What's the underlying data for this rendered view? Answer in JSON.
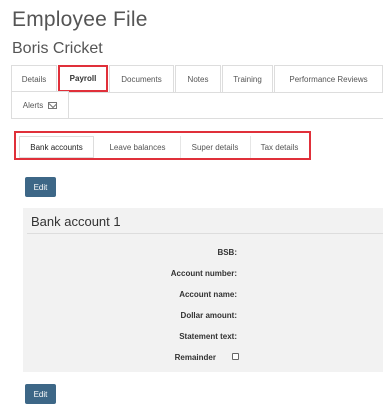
{
  "page": {
    "title": "Employee File",
    "employee_name": "Boris Cricket"
  },
  "main_tabs": [
    {
      "label": "Details",
      "active": false
    },
    {
      "label": "Payroll",
      "active": true
    },
    {
      "label": "Documents",
      "active": false
    },
    {
      "label": "Notes",
      "active": false
    },
    {
      "label": "Training",
      "active": false
    },
    {
      "label": "Performance Reviews",
      "active": false
    },
    {
      "label": "Alerts",
      "active": false,
      "icon": "envelope-icon"
    }
  ],
  "sub_tabs": [
    {
      "label": "Bank accounts",
      "active": true
    },
    {
      "label": "Leave balances",
      "active": false
    },
    {
      "label": "Super details",
      "active": false
    },
    {
      "label": "Tax details",
      "active": false
    }
  ],
  "buttons": {
    "edit_top": "Edit",
    "edit_bottom": "Edit"
  },
  "bank_account": {
    "title": "Bank account 1",
    "fields": [
      {
        "label": "BSB:",
        "value": ""
      },
      {
        "label": "Account number:",
        "value": ""
      },
      {
        "label": "Account name:",
        "value": ""
      },
      {
        "label": "Dollar amount:",
        "value": ""
      },
      {
        "label": "Statement text:",
        "value": ""
      },
      {
        "label": "Remainder",
        "value": ""
      }
    ],
    "remainder_checked": false
  },
  "colors": {
    "highlight": "#e0303a",
    "button": "#3d6787",
    "panel": "#f2f2f2"
  }
}
